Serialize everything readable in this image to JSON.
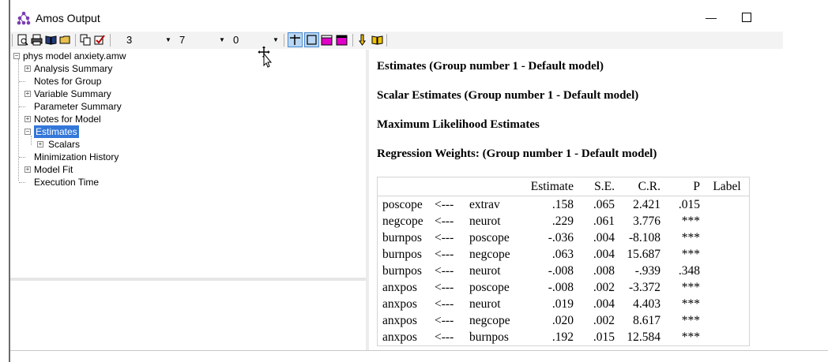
{
  "window": {
    "title": "Amos Output"
  },
  "toolbar": {
    "combo1_value": "3",
    "combo2_value": "7",
    "combo3_value": "0"
  },
  "tree": {
    "root": "phys model anxiety.amw",
    "items": [
      {
        "label": "Analysis Summary",
        "expandable": true
      },
      {
        "label": "Notes for Group",
        "expandable": false
      },
      {
        "label": "Variable Summary",
        "expandable": true
      },
      {
        "label": "Parameter Summary",
        "expandable": false
      },
      {
        "label": "Notes for Model",
        "expandable": true
      },
      {
        "label": "Estimates",
        "expandable": true,
        "selected": true
      },
      {
        "label": "Scalars",
        "expandable": true,
        "child": true
      },
      {
        "label": "Minimization History",
        "expandable": false
      },
      {
        "label": "Model Fit",
        "expandable": true
      },
      {
        "label": "Execution Time",
        "expandable": false
      }
    ]
  },
  "output": {
    "heading1": "Estimates (Group number 1 - Default model)",
    "heading2": "Scalar Estimates (Group number 1 - Default model)",
    "heading3": "Maximum Likelihood Estimates",
    "heading4": "Regression Weights: (Group number 1 - Default model)",
    "table": {
      "headers": [
        "",
        "",
        "",
        "Estimate",
        "S.E.",
        "C.R.",
        "P",
        "Label"
      ],
      "rows": [
        [
          "poscope",
          "<---",
          "extrav",
          ".158",
          ".065",
          "2.421",
          ".015",
          ""
        ],
        [
          "negcope",
          "<---",
          "neurot",
          ".229",
          ".061",
          "3.776",
          "***",
          ""
        ],
        [
          "burnpos",
          "<---",
          "poscope",
          "-.036",
          ".004",
          "-8.108",
          "***",
          ""
        ],
        [
          "burnpos",
          "<---",
          "negcope",
          ".063",
          ".004",
          "15.687",
          "***",
          ""
        ],
        [
          "burnpos",
          "<---",
          "neurot",
          "-.008",
          ".008",
          "-.939",
          ".348",
          ""
        ],
        [
          "anxpos",
          "<---",
          "poscope",
          "-.008",
          ".002",
          "-3.372",
          "***",
          ""
        ],
        [
          "anxpos",
          "<---",
          "neurot",
          ".019",
          ".004",
          "4.403",
          "***",
          ""
        ],
        [
          "anxpos",
          "<---",
          "negcope",
          ".020",
          ".002",
          "8.617",
          "***",
          ""
        ],
        [
          "anxpos",
          "<---",
          "burnpos",
          ".192",
          ".015",
          "12.584",
          "***",
          ""
        ]
      ]
    }
  }
}
